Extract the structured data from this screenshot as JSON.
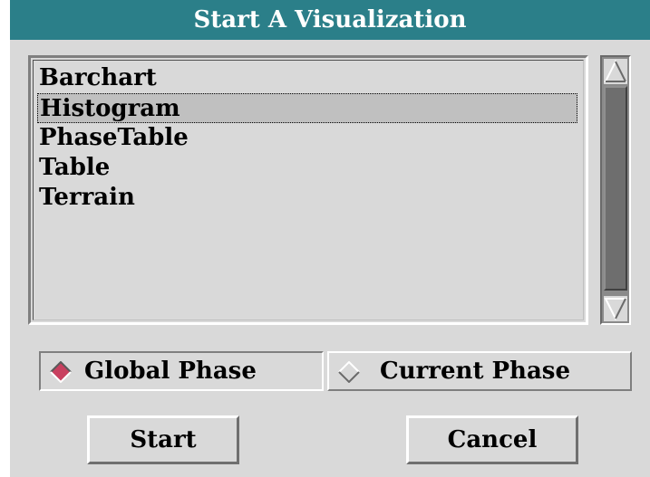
{
  "window": {
    "title": "Start A Visualization"
  },
  "list": {
    "items": [
      {
        "label": "Barchart",
        "selected": false
      },
      {
        "label": "Histogram",
        "selected": true
      },
      {
        "label": "PhaseTable",
        "selected": false
      },
      {
        "label": "Table",
        "selected": false
      },
      {
        "label": "Terrain",
        "selected": false
      }
    ]
  },
  "phase": {
    "global_label": "Global Phase",
    "current_label": "Current Phase",
    "selected": "global"
  },
  "buttons": {
    "start_label": "Start",
    "cancel_label": "Cancel"
  },
  "colors": {
    "title_bar": "#2b7f89",
    "radio_selected": "#c8405f",
    "background": "#d9d9d9"
  }
}
